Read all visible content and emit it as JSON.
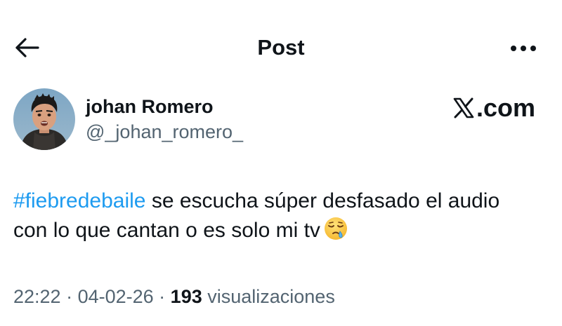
{
  "header": {
    "title": "Post"
  },
  "author": {
    "name": "johan Romero",
    "handle": "@_johan_romero_"
  },
  "brand": {
    "label": ".com"
  },
  "tweet": {
    "hashtag": "#fiebredebaile",
    "text": " se escucha súper desfasado el audio con lo que cantan o es solo mi tv",
    "emoji": "sleepy-face-emoji"
  },
  "meta": {
    "time": "22:22",
    "separator1": " · ",
    "date": "04-02-26",
    "separator2": " · ",
    "views_count": "193",
    "views_label": " visualizaciones"
  },
  "colors": {
    "link": "#1d9bf0",
    "secondary_text": "#536471",
    "primary_text": "#0f1419"
  }
}
